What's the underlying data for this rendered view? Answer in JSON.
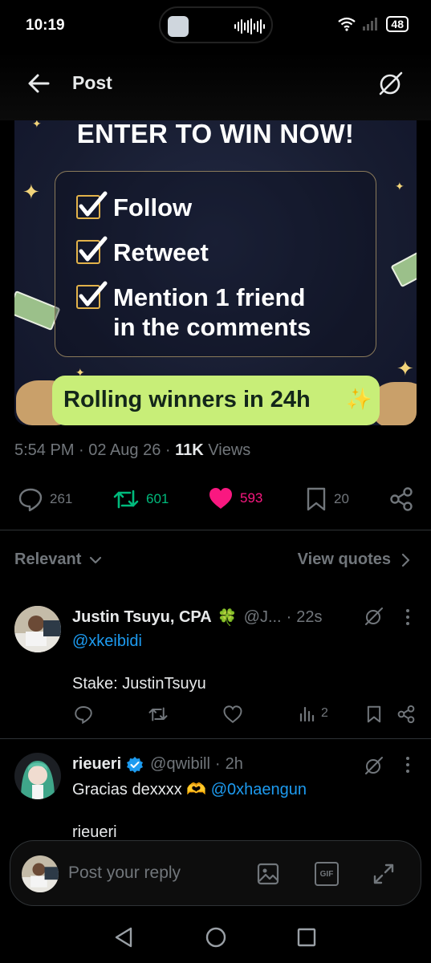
{
  "status_bar": {
    "time": "10:19",
    "battery": "48"
  },
  "header": {
    "title": "Post"
  },
  "promo": {
    "title": "ENTER TO WIN NOW!",
    "checklist": [
      "Follow",
      "Retweet",
      "Mention 1 friend",
      "in the comments"
    ],
    "pill": "Rolling winners in 24h",
    "pill_emoji": "✨"
  },
  "meta": {
    "time": "5:54 PM",
    "date": "02 Aug 26",
    "views_count": "11K",
    "views_label": "Views"
  },
  "actions": {
    "replies": "261",
    "reposts": "601",
    "likes": "593",
    "bookmarks": "20"
  },
  "colors": {
    "repost": "#00ba7c",
    "like": "#f91880",
    "mention": "#1d9bf0",
    "pill": "#c8ee78"
  },
  "filter": {
    "sort_label": "Relevant",
    "view_quotes": "View quotes"
  },
  "replies": [
    {
      "name": "Justin Tsuyu, CPA",
      "name_emoji": "🍀",
      "handle": "@J...",
      "time": "22s",
      "mention": "@xkeibidi",
      "text": "Stake: JustinTsuyu",
      "views": "2"
    },
    {
      "name": "rieueri",
      "verified": true,
      "handle": "@qwibill",
      "time": "2h",
      "text": "Gracias dexxxx",
      "text_emoji": "🫶",
      "mention": "@0xhaengun",
      "text2": "rieueri"
    }
  ],
  "composer": {
    "placeholder": "Post your reply",
    "gif_label": "GIF"
  }
}
